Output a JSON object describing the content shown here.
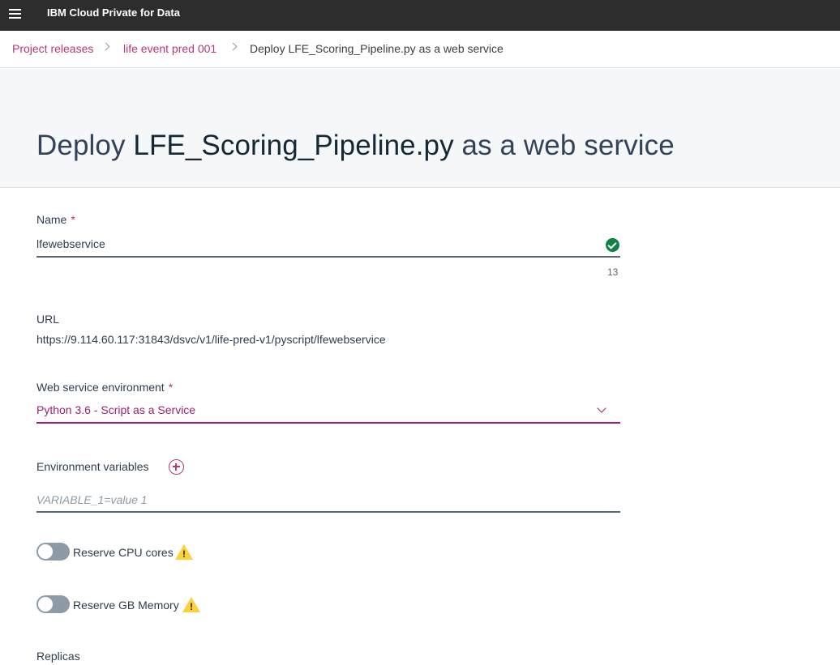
{
  "topbar": {
    "menu_icon": "hamburger-menu-icon",
    "app_title": "IBM Cloud Private for Data"
  },
  "breadcrumbs": {
    "items": [
      {
        "label": "Project releases"
      },
      {
        "label": "life event pred 001"
      },
      {
        "label": "Deploy LFE_Scoring_Pipeline.py as a web service"
      }
    ],
    "separator_icon": "chevron-right-icon"
  },
  "page": {
    "title_prefix": "Deploy ",
    "title_filename": "LFE_Scoring_Pipeline.py",
    "title_suffix": " as a web service"
  },
  "form": {
    "required_mark": "*",
    "name": {
      "label": "Name",
      "value": "lfewebservice",
      "char_count": "13",
      "status_icon": "check-circle-icon"
    },
    "url": {
      "label": "URL",
      "value": "https://9.114.60.117:31843/dsvc/v1/life-pred-v1/pyscript/lfewebservice"
    },
    "environment": {
      "label": "Web service environment",
      "selected": "Python 3.6 - Script as a Service",
      "dropdown_icon": "chevron-down-icon"
    },
    "env_variables": {
      "label": "Environment variables",
      "add_icon": "add-circle-icon",
      "placeholder": "VARIABLE_1=value 1"
    },
    "reserve_cpu": {
      "label": "Reserve CPU cores",
      "enabled": false,
      "warning_icon": "warning-icon"
    },
    "reserve_memory": {
      "label": "Reserve GB Memory",
      "enabled": false,
      "warning_icon": "warning-icon"
    },
    "replicas": {
      "label": "Replicas"
    }
  },
  "colors": {
    "topbar": "#2d2d2d",
    "accent": "#ba3579",
    "select_accent": "#9e2070",
    "success": "#0f8244",
    "warning": "#fdd13a"
  }
}
